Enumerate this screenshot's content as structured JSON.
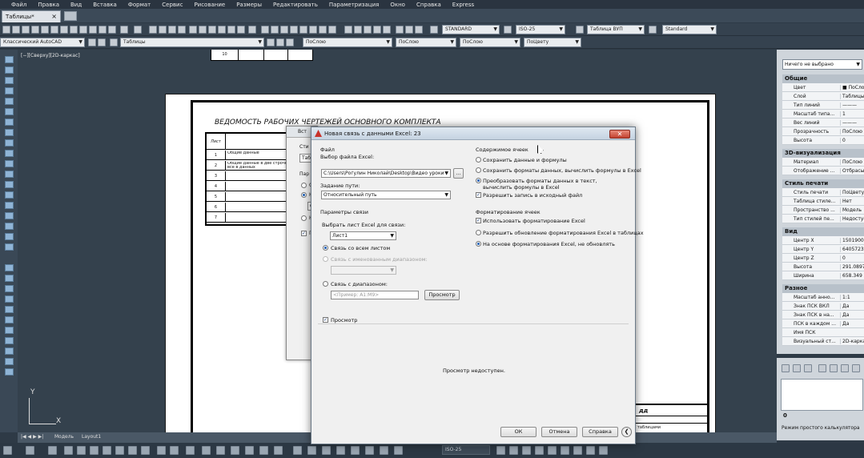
{
  "menu": [
    "Файл",
    "Правка",
    "Вид",
    "Вставка",
    "Формат",
    "Сервис",
    "Рисование",
    "Размеры",
    "Редактировать",
    "Параметризация",
    "Окно",
    "Справка",
    "Express"
  ],
  "doc_tab": "Таблицы*",
  "toolbar": {
    "text_style": "STANDARD",
    "dim_style": "ISO-25",
    "table_style": "Таблица ВУП",
    "multileader_style": "Standard",
    "workspace": "Классический AutoCAD",
    "layer": "Таблицы",
    "color": "ПоСлою",
    "linetype": "ПоСлою",
    "lineweight": "ПоСлою",
    "plotstyle": "ПоЦвету"
  },
  "viewport_label": "[−][Сверху][2D-каркас]",
  "drawing": {
    "top_cell": "10",
    "title": "ВЕДОМОСТЬ РАБОЧИХ ЧЕРТЕЖЕЙ ОСНОВНОГО КОМПЛЕКТА",
    "header": "Лист",
    "rows": [
      {
        "n": "1",
        "d": "Общие данные"
      },
      {
        "n": "2",
        "d": "Общие данные в две строчки все в данных"
      },
      {
        "n": "3",
        "d": ""
      },
      {
        "n": "4",
        "d": ""
      },
      {
        "n": "5",
        "d": ""
      },
      {
        "n": "6",
        "d": ""
      },
      {
        "n": "7",
        "d": ""
      }
    ],
    "stamp_code": "дд",
    "stamp_sub": "таблицами"
  },
  "ucs": {
    "y": "Y",
    "x": "X"
  },
  "model_tabs": [
    "Модель",
    "Layout1"
  ],
  "status_scale": "ISO-25",
  "properties": {
    "selector": "Ничего не выбрано",
    "sections": [
      {
        "name": "Общие",
        "rows": [
          [
            "Цвет",
            "■ ПоСлою"
          ],
          [
            "Слой",
            "Таблицы"
          ],
          [
            "Тип линий",
            "———"
          ],
          [
            "Масштаб типа...",
            "1"
          ],
          [
            "Вес линий",
            "———"
          ],
          [
            "Прозрачность",
            "ПоСлою"
          ],
          [
            "Высота",
            "0"
          ]
        ]
      },
      {
        "name": "3D-визуализация",
        "rows": [
          [
            "Материал",
            "ПоСлою"
          ],
          [
            "Отображение ...",
            "Отбрасыв"
          ]
        ]
      },
      {
        "name": "Стиль печати",
        "rows": [
          [
            "Стиль печати",
            "ПоЦвету"
          ],
          [
            "Таблица стиле...",
            "Нет"
          ],
          [
            "Пространство ...",
            "Модель"
          ],
          [
            "Тип стилей пе...",
            "Недоступ"
          ]
        ]
      },
      {
        "name": "Вид",
        "rows": [
          [
            "Центр X",
            "1501900.3"
          ],
          [
            "Центр Y",
            "6405723.0"
          ],
          [
            "Центр Z",
            "0"
          ],
          [
            "Высота",
            "291.0897"
          ],
          [
            "Ширина",
            "658.349"
          ]
        ]
      },
      {
        "name": "Разное",
        "rows": [
          [
            "Масштаб анно...",
            "1:1"
          ],
          [
            "Знак ПСК ВКЛ",
            "Да"
          ],
          [
            "Знак ПСК в на...",
            "Да"
          ],
          [
            "ПСК в каждом ...",
            "Да"
          ],
          [
            "Имя ПСК",
            ""
          ],
          [
            "Визуальный ст...",
            "2D-карка"
          ]
        ]
      }
    ]
  },
  "calc": {
    "value": "0",
    "label": "Режим простого калькулятора"
  },
  "bg_dialog": {
    "title": "Вст",
    "items": [
      "Сти",
      "Таб",
      "Пар",
      "С",
      "Н",
      "С",
      "Н",
      "Пр"
    ]
  },
  "dialog": {
    "title": "Новая связь с данными Excel: 23",
    "file_group": "Файл",
    "file_label": "Выбор файла Excel:",
    "file_path": "C:\\Users\\Рогулин Николай\\Desktop\\Видео уроки",
    "browse": "...",
    "path_label": "Задание пути:",
    "path_value": "Относительный путь",
    "link_group": "Параметры связи",
    "sheet_label": "Выбрать лист Excel для связи:",
    "sheet_value": "Лист1",
    "opt_all": "Связь со всем листом",
    "opt_named": "Связь с именованным диапазоном:",
    "opt_range": "Связь с диапазоном:",
    "range_placeholder": "<Пример: A1:M9>",
    "range_btn": "Просмотр",
    "content_group": "Содержимое ячеек",
    "c1": "Сохранить данные и формулы",
    "c2": "Сохранить форматы данных, вычислить формулы в Excel",
    "c3": "Преобразовать форматы данных в текст, вычислить формулы в Excel",
    "c4": "Разрешить запись в исходный файл",
    "format_group": "Форматирование ячеек",
    "f1": "Использовать форматирование Excel",
    "f2": "Разрешить обновление форматирования Excel в таблицах",
    "f3": "На основе форматирования Excel, не обновлять",
    "preview_label": "Просмотр",
    "preview_text": "Просмотр недоступен.",
    "ok": "ОК",
    "cancel": "Отмена",
    "help": "Справка",
    "expand": "❮",
    "close": "✕"
  }
}
